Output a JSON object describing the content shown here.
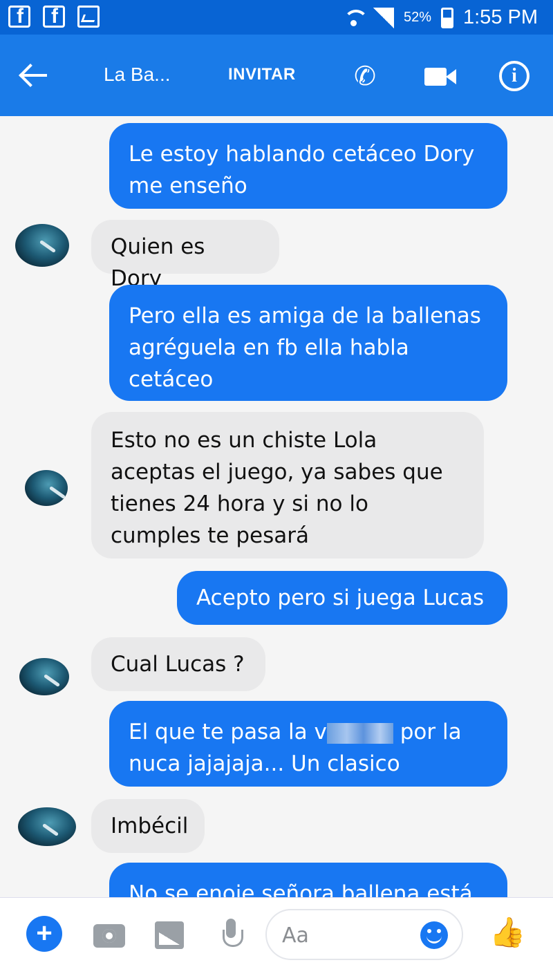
{
  "status_bar": {
    "battery_percent": "52%",
    "time": "1:55 PM",
    "left_icons": [
      "facebook-icon",
      "facebook-icon",
      "gallery-notification-icon"
    ]
  },
  "header": {
    "title": "La Ba...",
    "invite": "INVITAR",
    "icons": [
      "back-arrow-icon",
      "phone-icon",
      "video-camera-icon",
      "info-icon"
    ]
  },
  "messages": [
    {
      "side": "out",
      "text": "Le estoy hablando cetáceo Dory me enseño"
    },
    {
      "side": "in",
      "text": "Quien es Dory"
    },
    {
      "side": "out",
      "text": "Pero ella es amiga de la ballenas agréguela en fb ella habla cetáceo"
    },
    {
      "side": "in",
      "text": "Esto no es un chiste Lola aceptas el juego, ya sabes que tienes 24 hora y si no lo cumples te pesará"
    },
    {
      "side": "out",
      "text": "Acepto pero si juega Lucas"
    },
    {
      "side": "in",
      "text": "Cual Lucas ?"
    },
    {
      "side": "out",
      "text_before": "El que te pasa la v",
      "text_after": "por la nuca jajajaja... Un clasico",
      "redacted": true
    },
    {
      "side": "in",
      "text": "Imbécil"
    },
    {
      "side": "out",
      "text": "No se enoje señora ballena está"
    }
  ],
  "composer": {
    "placeholder": "Aa",
    "icons": [
      "plus-icon",
      "camera-icon",
      "image-icon",
      "microphone-icon",
      "emoji-icon",
      "thumbs-up-icon"
    ]
  },
  "colors": {
    "status_bar": "#0864d4",
    "header": "#1a7be8",
    "outgoing_bubble": "#1877f2",
    "incoming_bubble": "#e9e9ea"
  }
}
